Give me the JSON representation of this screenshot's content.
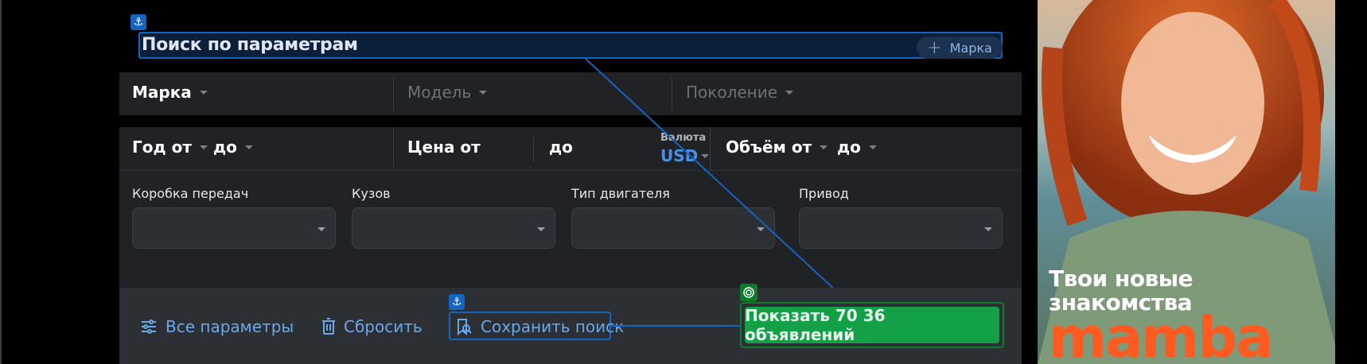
{
  "search_panel": {
    "title": "Поиск по параметрам",
    "marka_chip_label": "Марка",
    "row1": {
      "brand": "Марка",
      "model": "Модель",
      "generation": "Поколение"
    },
    "row2": {
      "year_from": "Год от",
      "year_to": "до",
      "price_from": "Цена от",
      "price_to": "до",
      "currency_label": "Валюта",
      "currency_value": "USD",
      "volume_from": "Объём от",
      "volume_to": "до"
    },
    "filters": [
      {
        "label": "Коробка передач",
        "value": ""
      },
      {
        "label": "Кузов",
        "value": ""
      },
      {
        "label": "Тип двигателя",
        "value": ""
      },
      {
        "label": "Привод",
        "value": ""
      }
    ],
    "actions": {
      "all_params": "Все параметры",
      "reset": "Сбросить",
      "save_search": "Сохранить поиск",
      "show_results": "Показать 70 3‌6 объявлений"
    }
  },
  "ad": {
    "tagline_line1": "Твои новые",
    "tagline_line2": "знакомства",
    "brand": "mamba"
  },
  "colors": {
    "accent_blue": "#4a90e2",
    "annotation_blue": "#1565c0",
    "primary_green": "#13a047",
    "ad_brand_orange": "#ff5a1f",
    "panel_bg": "#202226"
  }
}
